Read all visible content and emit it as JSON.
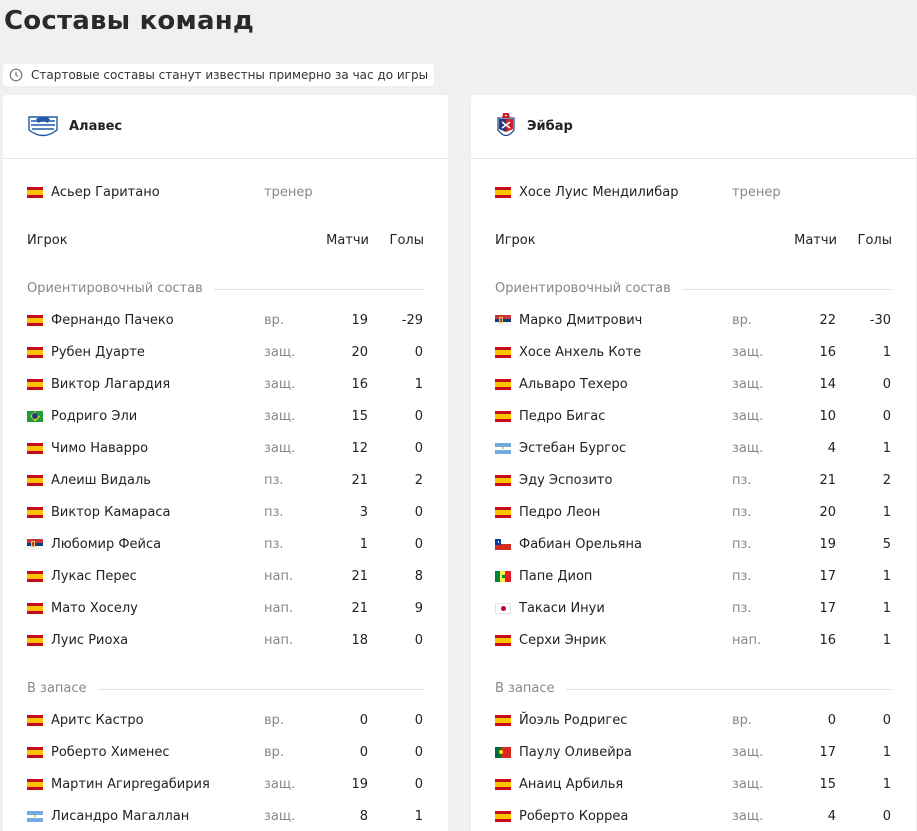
{
  "page_title": "Составы команд",
  "notice": "Стартовые составы станут известны примерно за час до игры",
  "columns": {
    "player": "Игрок",
    "matches": "Матчи",
    "goals": "Голы"
  },
  "sections": {
    "lineup": "Ориентировочный состав",
    "bench": "В запасе"
  },
  "colors": {
    "background": "#eff0f2",
    "card": "#ffffff",
    "muted": "#888888"
  },
  "teams": [
    {
      "name": "Алавес",
      "logo_icon": "alaves-crest-icon",
      "coach": {
        "name": "Асьер Гаритано",
        "role": "тренер",
        "flag": "spain"
      },
      "lineup": [
        {
          "name": "Фернандо Пачеко",
          "pos": "вр.",
          "matches": "19",
          "goals": "-29",
          "flag": "spain"
        },
        {
          "name": "Рубен Дуарте",
          "pos": "защ.",
          "matches": "20",
          "goals": "0",
          "flag": "spain"
        },
        {
          "name": "Виктор Лагардия",
          "pos": "защ.",
          "matches": "16",
          "goals": "1",
          "flag": "spain"
        },
        {
          "name": "Родриго Эли",
          "pos": "защ.",
          "matches": "15",
          "goals": "0",
          "flag": "brazil"
        },
        {
          "name": "Чимо Наварро",
          "pos": "защ.",
          "matches": "12",
          "goals": "0",
          "flag": "spain"
        },
        {
          "name": "Алеиш Видаль",
          "pos": "пз.",
          "matches": "21",
          "goals": "2",
          "flag": "spain"
        },
        {
          "name": "Виктор Камараса",
          "pos": "пз.",
          "matches": "3",
          "goals": "0",
          "flag": "spain"
        },
        {
          "name": "Любомир Фейса",
          "pos": "пз.",
          "matches": "1",
          "goals": "0",
          "flag": "serbia"
        },
        {
          "name": "Лукас Перес",
          "pos": "нап.",
          "matches": "21",
          "goals": "8",
          "flag": "spain"
        },
        {
          "name": "Мато Хоселу",
          "pos": "нап.",
          "matches": "21",
          "goals": "9",
          "flag": "spain"
        },
        {
          "name": "Луис Риоха",
          "pos": "нап.",
          "matches": "18",
          "goals": "0",
          "flag": "spain"
        }
      ],
      "bench": [
        {
          "name": "Аритс Кастро",
          "pos": "вр.",
          "matches": "0",
          "goals": "0",
          "flag": "spain"
        },
        {
          "name": "Роберто Хименес",
          "pos": "вр.",
          "matches": "0",
          "goals": "0",
          "flag": "spain"
        },
        {
          "name": "Мартин Агирregабирия",
          "pos": "защ.",
          "matches": "19",
          "goals": "0",
          "flag": "spain"
        },
        {
          "name": "Лисандро Магаллан",
          "pos": "защ.",
          "matches": "8",
          "goals": "1",
          "flag": "argentina"
        }
      ]
    },
    {
      "name": "Эйбар",
      "logo_icon": "eibar-crest-icon",
      "coach": {
        "name": "Хосе Луис Мендилибар",
        "role": "тренер",
        "flag": "spain"
      },
      "lineup": [
        {
          "name": "Марко Дмитрович",
          "pos": "вр.",
          "matches": "22",
          "goals": "-30",
          "flag": "serbia"
        },
        {
          "name": "Хосе Анхель Коте",
          "pos": "защ.",
          "matches": "16",
          "goals": "1",
          "flag": "spain"
        },
        {
          "name": "Альваро Техеро",
          "pos": "защ.",
          "matches": "14",
          "goals": "0",
          "flag": "spain"
        },
        {
          "name": "Педро Бигас",
          "pos": "защ.",
          "matches": "10",
          "goals": "0",
          "flag": "spain"
        },
        {
          "name": "Эстебан Бургос",
          "pos": "защ.",
          "matches": "4",
          "goals": "1",
          "flag": "argentina"
        },
        {
          "name": "Эду Эспозито",
          "pos": "пз.",
          "matches": "21",
          "goals": "2",
          "flag": "spain"
        },
        {
          "name": "Педро Леон",
          "pos": "пз.",
          "matches": "20",
          "goals": "1",
          "flag": "spain"
        },
        {
          "name": "Фабиан Орельяна",
          "pos": "пз.",
          "matches": "19",
          "goals": "5",
          "flag": "chile"
        },
        {
          "name": "Папе Диоп",
          "pos": "пз.",
          "matches": "17",
          "goals": "1",
          "flag": "senegal"
        },
        {
          "name": "Такаси Инуи",
          "pos": "пз.",
          "matches": "17",
          "goals": "1",
          "flag": "japan"
        },
        {
          "name": "Серхи Энрик",
          "pos": "нап.",
          "matches": "16",
          "goals": "1",
          "flag": "spain"
        }
      ],
      "bench": [
        {
          "name": "Йоэль Родригес",
          "pos": "вр.",
          "matches": "0",
          "goals": "0",
          "flag": "spain"
        },
        {
          "name": "Паулу Оливейра",
          "pos": "защ.",
          "matches": "17",
          "goals": "1",
          "flag": "portugal"
        },
        {
          "name": "Анаиц Арбилья",
          "pos": "защ.",
          "matches": "15",
          "goals": "1",
          "flag": "spain"
        },
        {
          "name": "Роберто Корреа",
          "pos": "защ.",
          "matches": "4",
          "goals": "0",
          "flag": "spain"
        }
      ]
    }
  ]
}
